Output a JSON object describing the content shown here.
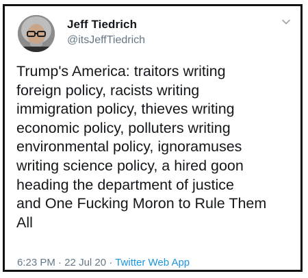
{
  "tweet": {
    "display_name": "Jeff Tiedrich",
    "handle": "@itsJeffTiedrich",
    "text_lines": [
      "Trump's America: traitors writing",
      "foreign policy, racists writing",
      "immigration policy, thieves writing",
      "economic policy, polluters writing",
      "environmental policy, ignoramuses",
      "writing science policy, a hired goon",
      "heading the department of justice",
      "and One Fucking Moron to Rule Them",
      "All"
    ],
    "time": "6:23 PM",
    "date": "22 Jul 20",
    "separator": "·",
    "source": "Twitter Web App",
    "avatar_icon": "user-avatar",
    "menu_icon": "chevron-down-icon"
  },
  "colors": {
    "text": "#14171a",
    "secondary": "#657786",
    "link": "#1b95e0",
    "border": "#111111"
  }
}
